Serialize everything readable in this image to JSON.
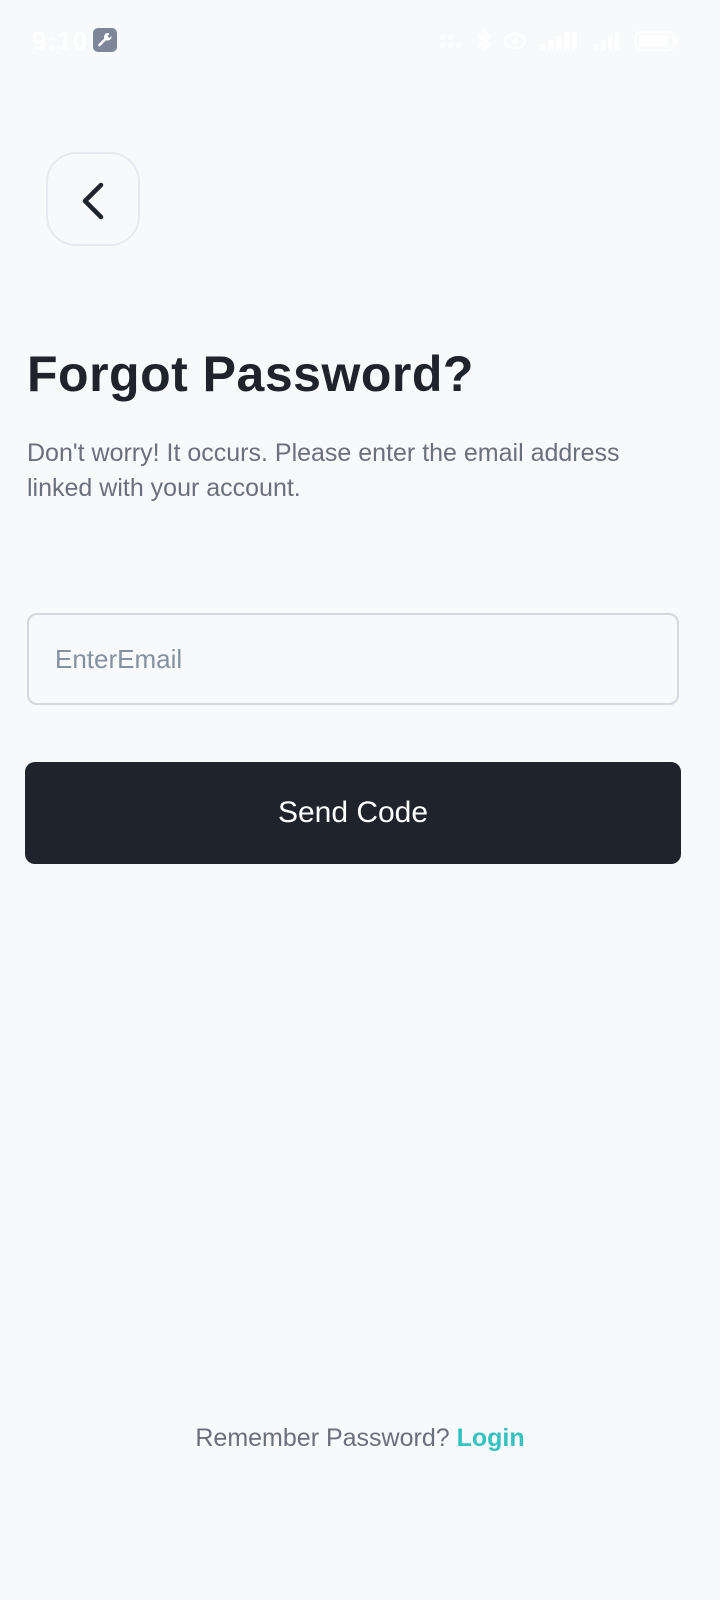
{
  "status_bar": {
    "time": "9:10",
    "icons": [
      "wrench-icon",
      "speed-icon",
      "bluetooth-icon",
      "hotspot-icon",
      "signal-icon",
      "signal-icon",
      "battery-icon"
    ]
  },
  "back_button": {
    "icon": "chevron-left-icon"
  },
  "header": {
    "title": "Forgot Password?",
    "subtitle": "Don't worry! It occurs. Please enter the email address linked with your account."
  },
  "form": {
    "email_placeholder": "EnterEmail",
    "email_value": "",
    "submit_label": "Send Code"
  },
  "footer": {
    "prompt": "Remember Password?",
    "link_label": "Login"
  },
  "colors": {
    "background": "#f8f9fa",
    "primary_dark": "#1e232c",
    "text_muted": "#6a707c",
    "accent": "#35c2c1"
  }
}
